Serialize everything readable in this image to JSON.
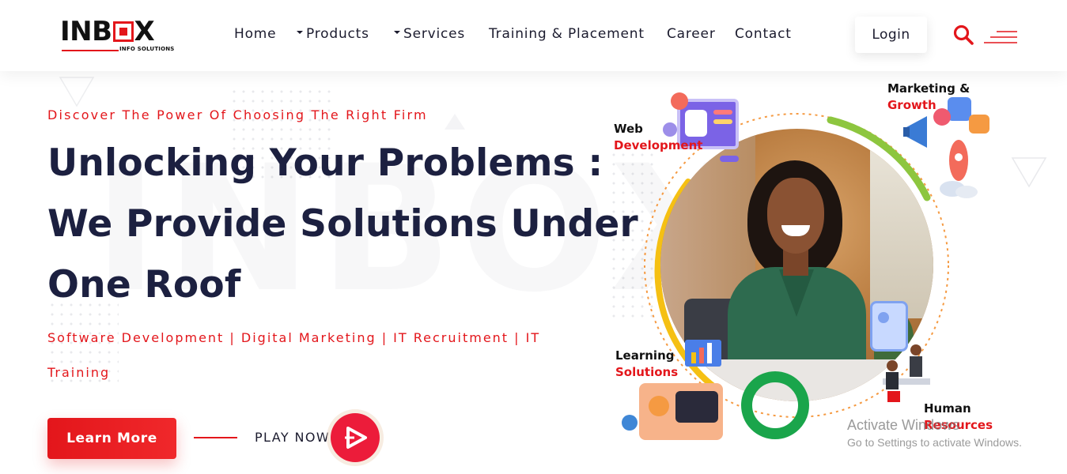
{
  "brand": {
    "logo_text_1": "INB",
    "logo_text_2": "X",
    "logo_sub": "INFO SOLUTIONS",
    "accent": "#e3161b",
    "dark": "#1c2040"
  },
  "nav": {
    "items": [
      {
        "label": "Home",
        "dropdown": false
      },
      {
        "label": "Products",
        "dropdown": true
      },
      {
        "label": "Services",
        "dropdown": true
      },
      {
        "label": "Training & Placement",
        "dropdown": false
      },
      {
        "label": "Career",
        "dropdown": false
      },
      {
        "label": "Contact",
        "dropdown": false
      }
    ],
    "login_label": "Login",
    "search_icon": "search-icon",
    "menu_icon": "hamburger-menu-icon"
  },
  "hero": {
    "watermark": "INBOXS",
    "eyebrow": "Discover The Power Of Choosing The Right Firm",
    "headline": [
      "Unlocking Your Problems :",
      "We Provide Solutions Under",
      "One Roof"
    ],
    "services_line": "Software Development | Digital Marketing | IT Recruitment | IT Training",
    "learn_more_label": "Learn More",
    "play_label": "PLAY NOW",
    "play_icon": "play-icon"
  },
  "illustration": {
    "web_dev": {
      "line1": "Web",
      "line2": "Development"
    },
    "marketing": {
      "line1": "Marketing &",
      "line2": "Growth"
    },
    "learning": {
      "line1": "Learning",
      "line2": "Solutions"
    },
    "hr": {
      "line1": "Human",
      "line2": "Resources"
    },
    "colors": {
      "yellow": "#f5c013",
      "green": "#8dc63f",
      "dark_green": "#1aa54b",
      "orange": "#f59a42"
    }
  },
  "os_overlay": {
    "line1": "Activate Windows",
    "line2": "Go to Settings to activate Windows."
  }
}
